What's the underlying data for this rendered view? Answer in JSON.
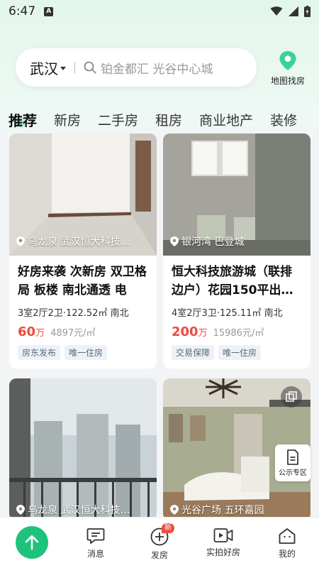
{
  "status_bar": {
    "time": "6:47",
    "notification_letter": "A"
  },
  "search": {
    "city": "武汉",
    "placeholder": "铂金都汇 光谷中心城"
  },
  "map_button": {
    "label": "地图找房"
  },
  "tabs": [
    {
      "label": "推荐",
      "active": true
    },
    {
      "label": "新房"
    },
    {
      "label": "二手房"
    },
    {
      "label": "租房"
    },
    {
      "label": "商业地产"
    },
    {
      "label": "装修"
    }
  ],
  "listings": [
    {
      "location": "乌龙泉 武汉恒大科技…",
      "title": "好房来袭 次新房 双卫格局 板楼 南北通透 电梯…",
      "spec": "3室2厅2卫·122.52㎡ 南北",
      "price": "60",
      "price_unit": "万",
      "unit_price": "4897元/㎡",
      "tags": [
        "房东发布",
        "唯一住房"
      ]
    },
    {
      "location": "银河湾 巴登城",
      "title": "恒大科技旅游城（联排边户）花园150平出…",
      "spec": "4室2厅3卫·125.11㎡ 南北",
      "price": "200",
      "price_unit": "万",
      "unit_price": "15986元/㎡",
      "tags": [
        "交易保障",
        "唯一住房"
      ]
    },
    {
      "location": "乌龙泉 武汉恒大科技…"
    },
    {
      "location": "光谷广场 五环嘉园"
    }
  ],
  "public_zone": {
    "label": "公示专区"
  },
  "bottom_nav": {
    "items": [
      {
        "label": "消息"
      },
      {
        "label": "发房",
        "badge": "新"
      },
      {
        "label": "实拍好房"
      },
      {
        "label": "我的"
      }
    ]
  },
  "colors": {
    "accent": "#1fc27a",
    "price": "#f04a3e"
  }
}
